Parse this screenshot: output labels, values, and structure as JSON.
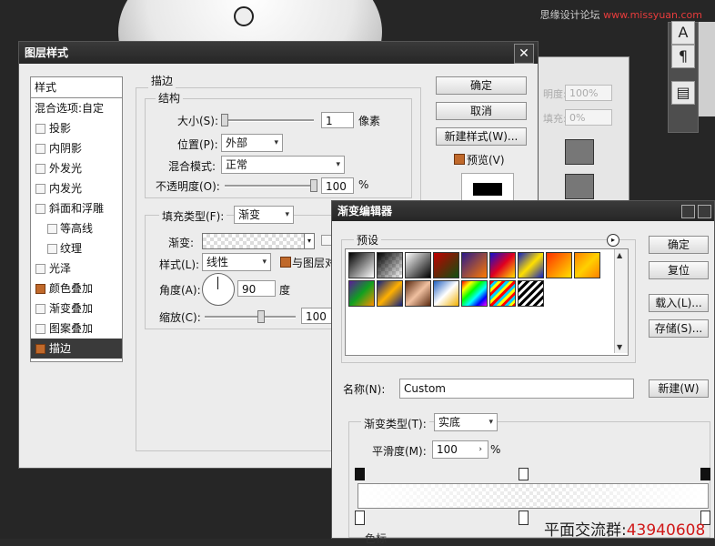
{
  "watermark": {
    "part1": "思缘设计论坛",
    "part2": "www.missyuan.com"
  },
  "tools": {
    "type_glyph": "A",
    "para_glyph": "¶",
    "panel_glyph": "▤"
  },
  "back_panel": {
    "opacity_label": "明度:",
    "opacity_value": "100%",
    "fill_label": "填充:",
    "fill_value": "0%"
  },
  "layer_style": {
    "title": "图层样式",
    "close_glyph": "✕",
    "styles_header": "样式",
    "blend_options": "混合选项:自定",
    "items": [
      {
        "label": "投影",
        "checked": false
      },
      {
        "label": "内阴影",
        "checked": false
      },
      {
        "label": "外发光",
        "checked": false
      },
      {
        "label": "内发光",
        "checked": false
      },
      {
        "label": "斜面和浮雕",
        "checked": false
      },
      {
        "label": "等高线",
        "checked": false
      },
      {
        "label": "纹理",
        "checked": false
      },
      {
        "label": "光泽",
        "checked": false
      },
      {
        "label": "颜色叠加",
        "checked": true
      },
      {
        "label": "渐变叠加",
        "checked": false
      },
      {
        "label": "图案叠加",
        "checked": false
      },
      {
        "label": "描边",
        "checked": true
      }
    ],
    "stroke_title": "描边",
    "structure_title": "结构",
    "size_label": "大小(S):",
    "size_value": "1",
    "size_unit": "像素",
    "position_label": "位置(P):",
    "position_value": "外部",
    "blend_mode_label": "混合模式:",
    "blend_mode_value": "正常",
    "opacity_label": "不透明度(O):",
    "opacity_value": "100",
    "opacity_unit": "%",
    "fill_type_label": "填充类型(F):",
    "fill_type_value": "渐变",
    "gradient_label": "渐变:",
    "style_label": "样式(L):",
    "style_value": "线性",
    "align_label": "与图层对",
    "angle_label": "角度(A):",
    "angle_value": "90",
    "angle_unit": "度",
    "scale_label": "缩放(C):",
    "scale_value": "100",
    "ok": "确定",
    "cancel": "取消",
    "new_style": "新建样式(W)...",
    "preview_label": "预览(V)"
  },
  "gradient_editor": {
    "title": "渐变编辑器",
    "presets_label": "预设",
    "presets_menu_glyph": "▸",
    "ok": "确定",
    "reset": "复位",
    "load": "载入(L)...",
    "save": "存储(S)...",
    "name_label": "名称(N):",
    "name_value": "Custom",
    "new_button": "新建(W)",
    "type_label": "渐变类型(T):",
    "type_value": "实底",
    "smooth_label": "平滑度(M):",
    "smooth_value": "100",
    "smooth_unit": "%",
    "color_label": "色标",
    "swatch_count_row1": 9,
    "swatch_count_row2": 7
  },
  "bottom_text": {
    "label": "平面交流群:",
    "number": "43940608"
  }
}
